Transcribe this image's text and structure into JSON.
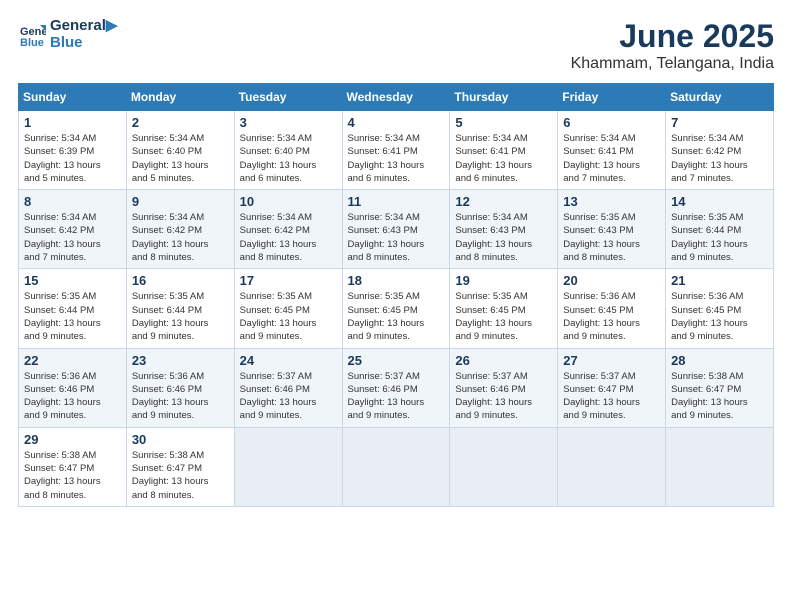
{
  "logo": {
    "line1": "General",
    "line2": "Blue"
  },
  "title": "June 2025",
  "subtitle": "Khammam, Telangana, India",
  "weekdays": [
    "Sunday",
    "Monday",
    "Tuesday",
    "Wednesday",
    "Thursday",
    "Friday",
    "Saturday"
  ],
  "weeks": [
    [
      {
        "day": "1",
        "sunrise": "5:34 AM",
        "sunset": "6:39 PM",
        "daylight": "13 hours and 5 minutes."
      },
      {
        "day": "2",
        "sunrise": "5:34 AM",
        "sunset": "6:40 PM",
        "daylight": "13 hours and 5 minutes."
      },
      {
        "day": "3",
        "sunrise": "5:34 AM",
        "sunset": "6:40 PM",
        "daylight": "13 hours and 6 minutes."
      },
      {
        "day": "4",
        "sunrise": "5:34 AM",
        "sunset": "6:41 PM",
        "daylight": "13 hours and 6 minutes."
      },
      {
        "day": "5",
        "sunrise": "5:34 AM",
        "sunset": "6:41 PM",
        "daylight": "13 hours and 6 minutes."
      },
      {
        "day": "6",
        "sunrise": "5:34 AM",
        "sunset": "6:41 PM",
        "daylight": "13 hours and 7 minutes."
      },
      {
        "day": "7",
        "sunrise": "5:34 AM",
        "sunset": "6:42 PM",
        "daylight": "13 hours and 7 minutes."
      }
    ],
    [
      {
        "day": "8",
        "sunrise": "5:34 AM",
        "sunset": "6:42 PM",
        "daylight": "13 hours and 7 minutes."
      },
      {
        "day": "9",
        "sunrise": "5:34 AM",
        "sunset": "6:42 PM",
        "daylight": "13 hours and 8 minutes."
      },
      {
        "day": "10",
        "sunrise": "5:34 AM",
        "sunset": "6:42 PM",
        "daylight": "13 hours and 8 minutes."
      },
      {
        "day": "11",
        "sunrise": "5:34 AM",
        "sunset": "6:43 PM",
        "daylight": "13 hours and 8 minutes."
      },
      {
        "day": "12",
        "sunrise": "5:34 AM",
        "sunset": "6:43 PM",
        "daylight": "13 hours and 8 minutes."
      },
      {
        "day": "13",
        "sunrise": "5:35 AM",
        "sunset": "6:43 PM",
        "daylight": "13 hours and 8 minutes."
      },
      {
        "day": "14",
        "sunrise": "5:35 AM",
        "sunset": "6:44 PM",
        "daylight": "13 hours and 9 minutes."
      }
    ],
    [
      {
        "day": "15",
        "sunrise": "5:35 AM",
        "sunset": "6:44 PM",
        "daylight": "13 hours and 9 minutes."
      },
      {
        "day": "16",
        "sunrise": "5:35 AM",
        "sunset": "6:44 PM",
        "daylight": "13 hours and 9 minutes."
      },
      {
        "day": "17",
        "sunrise": "5:35 AM",
        "sunset": "6:45 PM",
        "daylight": "13 hours and 9 minutes."
      },
      {
        "day": "18",
        "sunrise": "5:35 AM",
        "sunset": "6:45 PM",
        "daylight": "13 hours and 9 minutes."
      },
      {
        "day": "19",
        "sunrise": "5:35 AM",
        "sunset": "6:45 PM",
        "daylight": "13 hours and 9 minutes."
      },
      {
        "day": "20",
        "sunrise": "5:36 AM",
        "sunset": "6:45 PM",
        "daylight": "13 hours and 9 minutes."
      },
      {
        "day": "21",
        "sunrise": "5:36 AM",
        "sunset": "6:45 PM",
        "daylight": "13 hours and 9 minutes."
      }
    ],
    [
      {
        "day": "22",
        "sunrise": "5:36 AM",
        "sunset": "6:46 PM",
        "daylight": "13 hours and 9 minutes."
      },
      {
        "day": "23",
        "sunrise": "5:36 AM",
        "sunset": "6:46 PM",
        "daylight": "13 hours and 9 minutes."
      },
      {
        "day": "24",
        "sunrise": "5:37 AM",
        "sunset": "6:46 PM",
        "daylight": "13 hours and 9 minutes."
      },
      {
        "day": "25",
        "sunrise": "5:37 AM",
        "sunset": "6:46 PM",
        "daylight": "13 hours and 9 minutes."
      },
      {
        "day": "26",
        "sunrise": "5:37 AM",
        "sunset": "6:46 PM",
        "daylight": "13 hours and 9 minutes."
      },
      {
        "day": "27",
        "sunrise": "5:37 AM",
        "sunset": "6:47 PM",
        "daylight": "13 hours and 9 minutes."
      },
      {
        "day": "28",
        "sunrise": "5:38 AM",
        "sunset": "6:47 PM",
        "daylight": "13 hours and 9 minutes."
      }
    ],
    [
      {
        "day": "29",
        "sunrise": "5:38 AM",
        "sunset": "6:47 PM",
        "daylight": "13 hours and 8 minutes."
      },
      {
        "day": "30",
        "sunrise": "5:38 AM",
        "sunset": "6:47 PM",
        "daylight": "13 hours and 8 minutes."
      },
      null,
      null,
      null,
      null,
      null
    ]
  ],
  "labels": {
    "sunrise": "Sunrise:",
    "sunset": "Sunset:",
    "daylight": "Daylight:"
  }
}
